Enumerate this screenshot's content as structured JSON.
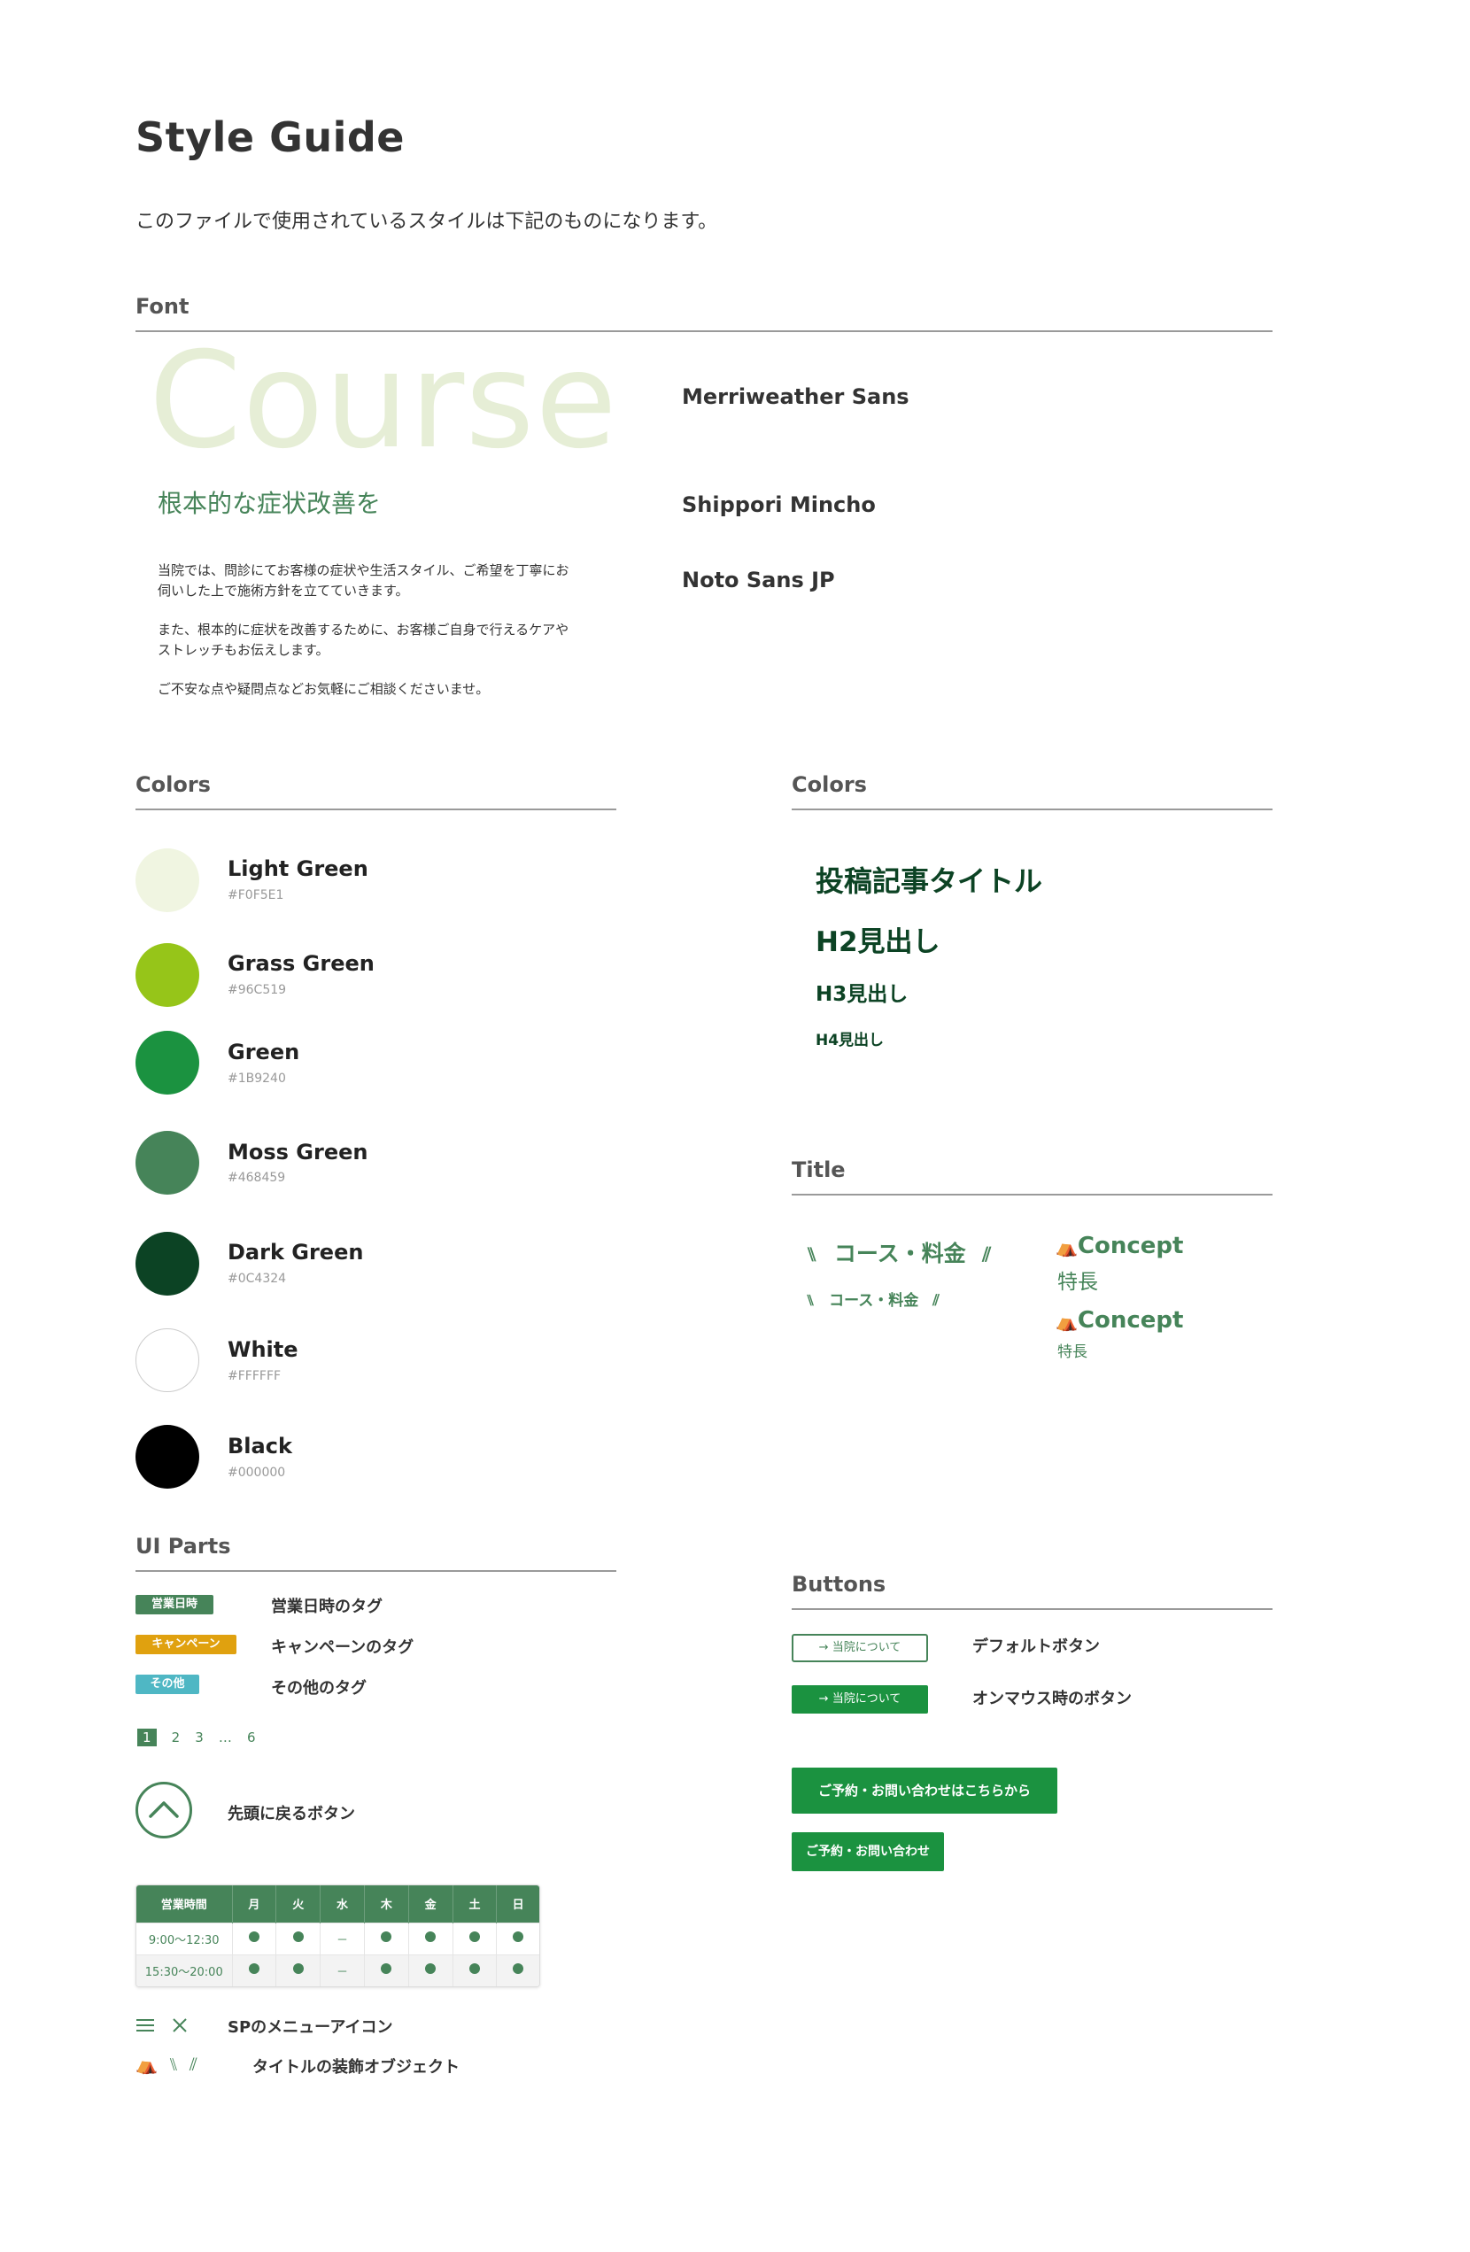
{
  "header": {
    "title": "Style Guide",
    "description": "このファイルで使用されているスタイルは下記のものになります。"
  },
  "font_section": {
    "title": "Font",
    "sample_word": "Course",
    "sample_heading": "根本的な症状改善を",
    "paragraph_lines": [
      "当院では、問診にてお客様の症状や生活スタイル、ご希望を丁寧にお",
      "伺いした上で施術方針を立てていきます。",
      "また、根本的に症状を改善するために、お客様ご自身で行えるケアや",
      "ストレッチもお伝えします。",
      "ご不安な点や疑問点などお気軽にご相談くださいませ。"
    ],
    "font_names": [
      "Merriweather Sans",
      "Shippori Mincho",
      "Noto Sans JP"
    ]
  },
  "colors_section": {
    "title": "Colors",
    "swatches": [
      {
        "name": "Light Green",
        "hex": "#F0F5E1",
        "color": "#f0f5e1"
      },
      {
        "name": "Grass Green",
        "hex": "#96C519",
        "color": "#96c519"
      },
      {
        "name": "Green",
        "hex": "#1B9240",
        "color": "#1b9240"
      },
      {
        "name": "Moss Green",
        "hex": "#468459",
        "color": "#468459"
      },
      {
        "name": "Dark Green",
        "hex": "#0C4324",
        "color": "#0c4324"
      },
      {
        "name": "White",
        "hex": "#FFFFFF",
        "color": "#ffffff"
      },
      {
        "name": "Black",
        "hex": "#000000",
        "color": "#000000"
      }
    ]
  },
  "typography_section": {
    "title": "Colors",
    "post_title": "投稿記事タイトル",
    "h2": "H2見出し",
    "h3": "H3見出し",
    "h4": "H4見出し"
  },
  "title_section": {
    "title": "Title",
    "course_large": "コース・料金",
    "course_small": "コース・料金",
    "concept_en": "Concept",
    "concept_ja": "特長"
  },
  "ui_parts": {
    "title": "UI Parts",
    "tags": [
      {
        "label": "営業日時",
        "desc": "営業日時のタグ",
        "color": "#468459"
      },
      {
        "label": "キャンペーン",
        "desc": "キャンペーンのタグ",
        "color": "#e0a10f"
      },
      {
        "label": "その他",
        "desc": "その他のタグ",
        "color": "#4fb7c4"
      }
    ],
    "pager": {
      "items": [
        "1",
        "2",
        "3",
        "…",
        "6"
      ]
    },
    "back_to_top_label": "先頭に戻るボタン",
    "hours_table": {
      "headers": [
        "営業時間",
        "月",
        "火",
        "水",
        "木",
        "金",
        "土",
        "日"
      ],
      "rows": [
        {
          "time": "9:00〜12:30",
          "cells": [
            "●",
            "●",
            "－",
            "●",
            "●",
            "●",
            "●"
          ]
        },
        {
          "time": "15:30〜20:00",
          "cells": [
            "●",
            "●",
            "－",
            "●",
            "●",
            "●",
            "●"
          ]
        }
      ]
    },
    "sp_menu_label": "SPのメニューアイコン",
    "deco_label": "タイトルの装飾オブジェクト"
  },
  "buttons_section": {
    "title": "Buttons",
    "default_btn": "→ 当院について",
    "default_desc": "デフォルトボタン",
    "hover_btn": "→ 当院について",
    "hover_desc": "オンマウス時のボタン",
    "cta_large": "ご予約・お問い合わせはこちらから",
    "cta_small": "ご予約・お問い合わせ"
  }
}
